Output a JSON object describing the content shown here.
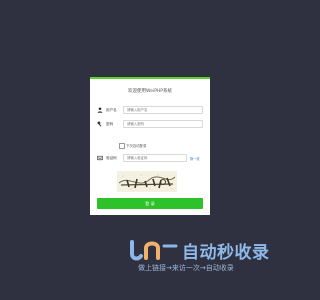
{
  "login": {
    "title": "欢迎使用WeiPHP系统",
    "username_label": "用户名",
    "username_placeholder": "请输入用户名",
    "password_label": "密码",
    "password_placeholder": "请输入密码",
    "remember_label": "下次自动登录",
    "captcha_label": "验证码",
    "captcha_placeholder": "请输入验证码",
    "refresh_label": "换一张",
    "submit_label": "登 录"
  },
  "watermark": {
    "title": "自动秒收录",
    "subtitle": "做上链接→来访一次→自动收录"
  },
  "colors": {
    "background": "#2f3140",
    "accent": "#2ec22a",
    "card": "#ffffff"
  },
  "icons": {
    "username": "user-icon",
    "password": "key-icon",
    "captcha": "keyboard-icon"
  }
}
